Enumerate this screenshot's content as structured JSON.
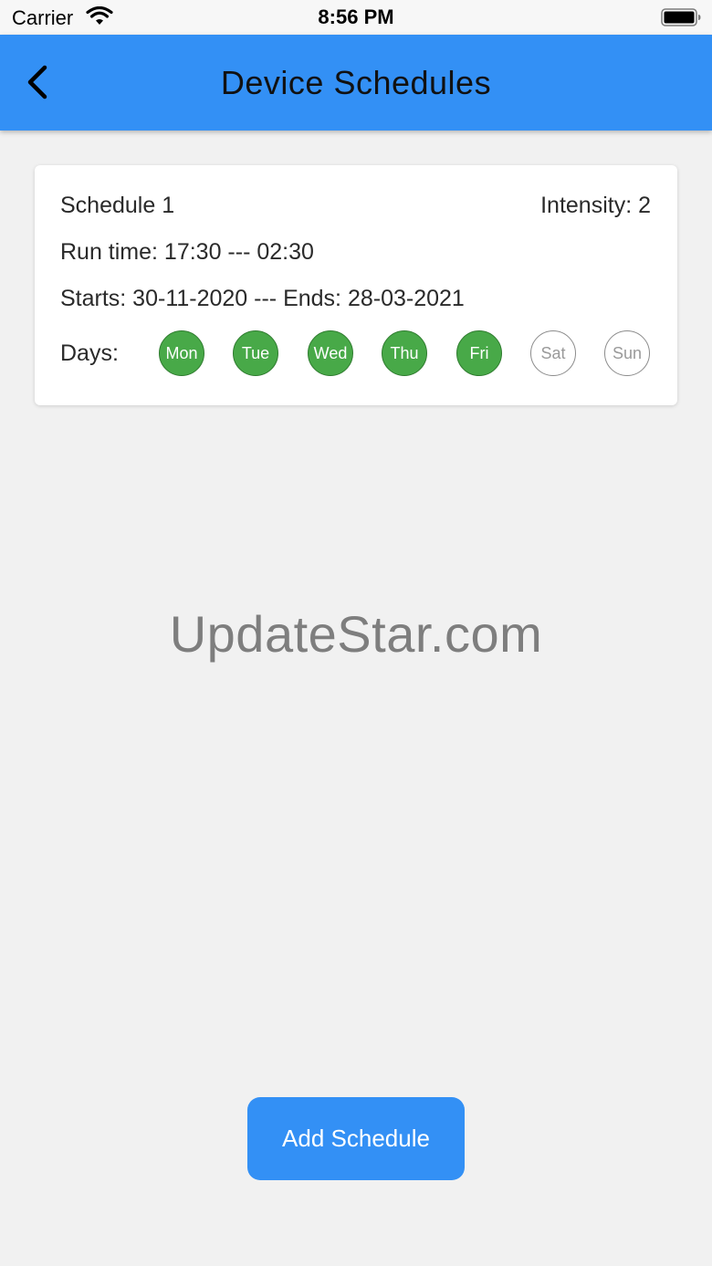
{
  "status_bar": {
    "carrier": "Carrier",
    "time": "8:56 PM",
    "wifi_icon": "wifi-icon",
    "battery_icon": "battery-icon"
  },
  "app_bar": {
    "title": "Device Schedules",
    "back_icon": "chevron-left-icon",
    "color": "#3390f5"
  },
  "schedule": {
    "name": "Schedule 1",
    "intensity": "Intensity: 2",
    "run_time": "Run time: 17:30 --- 02:30",
    "dates": "Starts: 30-11-2020 --- Ends: 28-03-2021",
    "days_label": "Days:",
    "days": [
      {
        "label": "Mon",
        "active": true
      },
      {
        "label": "Tue",
        "active": true
      },
      {
        "label": "Wed",
        "active": true
      },
      {
        "label": "Thu",
        "active": true
      },
      {
        "label": "Fri",
        "active": true
      },
      {
        "label": "Sat",
        "active": false
      },
      {
        "label": "Sun",
        "active": false
      }
    ],
    "active_color": "#48a948"
  },
  "watermark": "UpdateStar.com",
  "add_button": {
    "label": "Add Schedule"
  }
}
